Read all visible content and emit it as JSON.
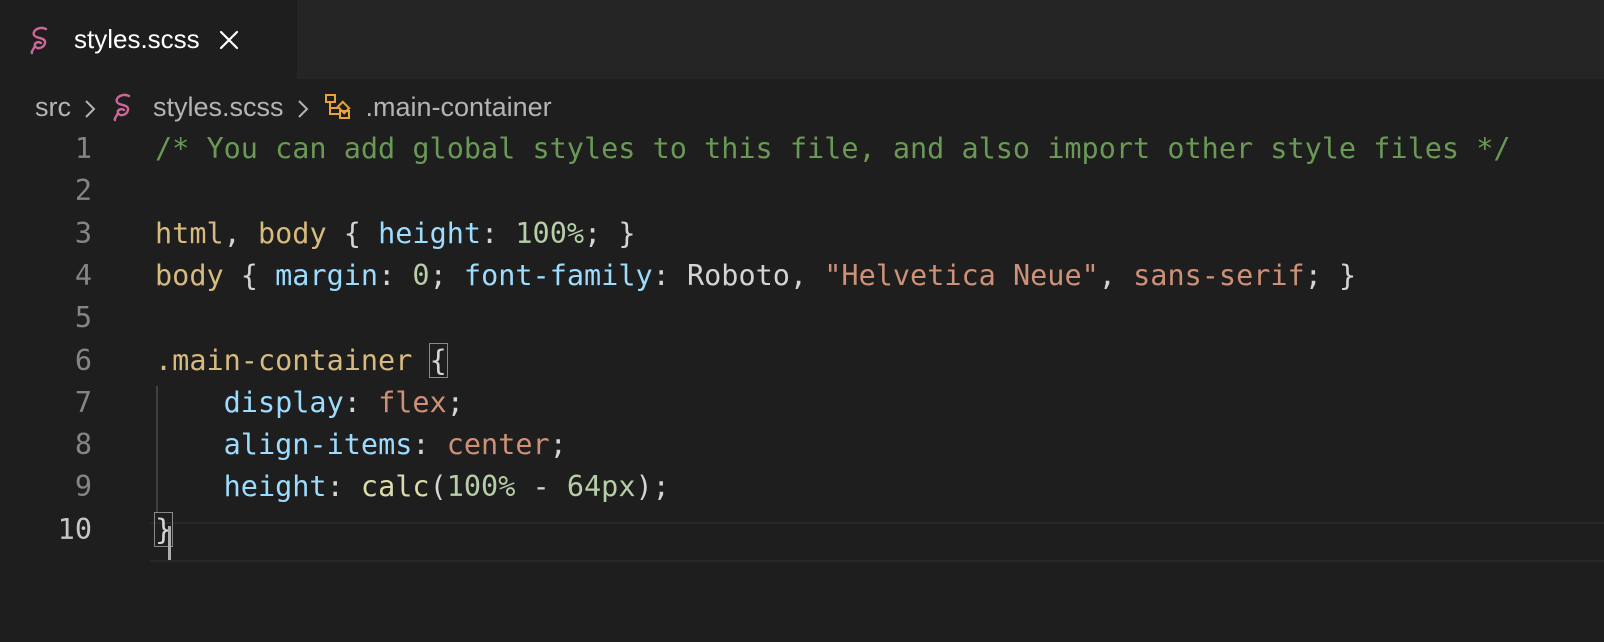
{
  "tab": {
    "label": "styles.scss",
    "icon": "sass-icon",
    "close_icon": "close-icon"
  },
  "breadcrumb": {
    "items": [
      "src",
      "styles.scss",
      ".main-container"
    ],
    "icons": [
      "sass-icon",
      "css-selector-icon"
    ]
  },
  "editor": {
    "active_line": "10",
    "lines": [
      {
        "n": "1",
        "tokens": [
          [
            "/* You can add global styles to this file, and also import other style files */",
            "comment"
          ]
        ]
      },
      {
        "n": "2",
        "tokens": []
      },
      {
        "n": "3",
        "tokens": [
          [
            "html",
            "sel"
          ],
          [
            ", ",
            "plain"
          ],
          [
            "body",
            "sel"
          ],
          [
            " { ",
            "plain"
          ],
          [
            "height",
            "prop"
          ],
          [
            ": ",
            "plain"
          ],
          [
            "100%",
            "num"
          ],
          [
            "; }",
            "plain"
          ]
        ]
      },
      {
        "n": "4",
        "tokens": [
          [
            "body",
            "sel"
          ],
          [
            " { ",
            "plain"
          ],
          [
            "margin",
            "prop"
          ],
          [
            ": ",
            "plain"
          ],
          [
            "0",
            "num"
          ],
          [
            "; ",
            "plain"
          ],
          [
            "font-family",
            "prop"
          ],
          [
            ": Roboto, ",
            "plain"
          ],
          [
            "\"Helvetica Neue\"",
            "str"
          ],
          [
            ", ",
            "plain"
          ],
          [
            "sans-serif",
            "str"
          ],
          [
            "; }",
            "plain"
          ]
        ]
      },
      {
        "n": "5",
        "tokens": []
      },
      {
        "n": "6",
        "tokens": [
          [
            ".main-container",
            "sel"
          ],
          [
            " ",
            "plain"
          ],
          [
            "{",
            "brace"
          ]
        ]
      },
      {
        "n": "7",
        "tokens": [
          [
            "    ",
            "plain"
          ],
          [
            "display",
            "prop"
          ],
          [
            ": ",
            "plain"
          ],
          [
            "flex",
            "str"
          ],
          [
            ";",
            "plain"
          ]
        ]
      },
      {
        "n": "8",
        "tokens": [
          [
            "    ",
            "plain"
          ],
          [
            "align-items",
            "prop"
          ],
          [
            ": ",
            "plain"
          ],
          [
            "center",
            "str"
          ],
          [
            ";",
            "plain"
          ]
        ]
      },
      {
        "n": "9",
        "tokens": [
          [
            "    ",
            "plain"
          ],
          [
            "height",
            "prop"
          ],
          [
            ": ",
            "plain"
          ],
          [
            "calc",
            "fn"
          ],
          [
            "(",
            "plain"
          ],
          [
            "100%",
            "num"
          ],
          [
            " - ",
            "plain"
          ],
          [
            "64px",
            "num"
          ],
          [
            ");",
            "plain"
          ]
        ]
      },
      {
        "n": "10",
        "tokens": [
          [
            "}",
            "brace"
          ]
        ]
      }
    ]
  },
  "colors": {
    "background": "#1e1e1e",
    "tabbar": "#252526",
    "comment": "#6a9955",
    "selector": "#d7ba7d",
    "property": "#9cdcfe",
    "number": "#b5cea8",
    "string": "#ce9178",
    "function": "#dcdcaa",
    "sass_pink": "#cd6799",
    "selector_icon": "#e8a33d"
  }
}
